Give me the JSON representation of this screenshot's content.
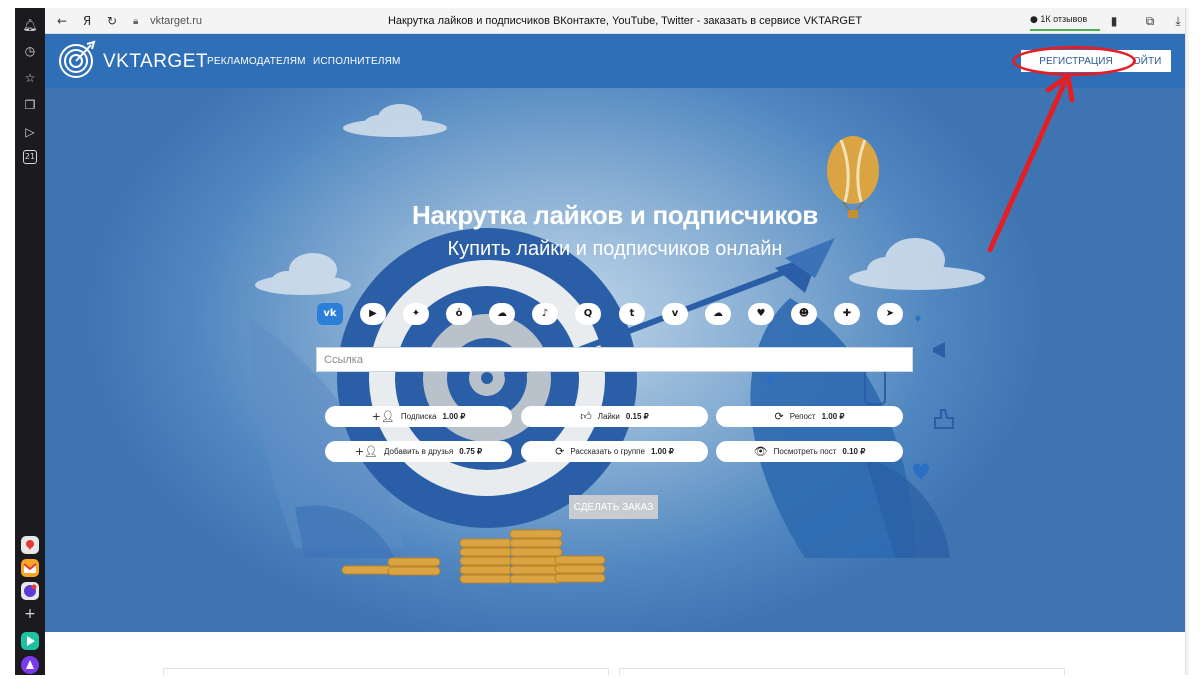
{
  "browser": {
    "url": "vktarget.ru",
    "tab_title": "Накрутка лайков и подписчиков ВКонтакте, YouTube, Twitter - заказать в сервисе VKTARGET",
    "reviews": "1К отзывов",
    "yandex_glyph": "Я",
    "side_badge": "21"
  },
  "header": {
    "logo": "VKTARGET",
    "nav": [
      "РЕКЛАМОДАТЕЛЯМ",
      "ИСПОЛНИТЕЛЯМ"
    ],
    "register": "РЕГИСТРАЦИЯ",
    "login": "ОЙТИ"
  },
  "hero": {
    "title": "Накрутка лайков и подписчиков",
    "subtitle": "Купить лайки и подписчиков онлайн",
    "link_placeholder": "Ссылка",
    "order_button": "СДЕЛАТЬ ЗАКАЗ"
  },
  "socials": [
    {
      "name": "vk-icon",
      "glyph": "vk",
      "active": true
    },
    {
      "name": "youtube-icon",
      "glyph": "▶"
    },
    {
      "name": "twitter-icon",
      "glyph": "✦"
    },
    {
      "name": "odnoklassniki-icon",
      "glyph": "ὀ"
    },
    {
      "name": "cloud-icon",
      "glyph": "☁"
    },
    {
      "name": "tiktok-icon",
      "glyph": "♪"
    },
    {
      "name": "q-icon",
      "glyph": "Q"
    },
    {
      "name": "t-icon",
      "glyph": "t"
    },
    {
      "name": "vimeo-icon",
      "glyph": "v"
    },
    {
      "name": "soundcloud-icon",
      "glyph": "☁"
    },
    {
      "name": "heart-icon",
      "glyph": "♥"
    },
    {
      "name": "reddit-icon",
      "glyph": "☻"
    },
    {
      "name": "plus-icon",
      "glyph": "✚"
    },
    {
      "name": "telegram-icon",
      "glyph": "➤"
    }
  ],
  "services": [
    {
      "icon": "user-plus-icon",
      "glyph": "+👤",
      "label": "Подписка",
      "price": "1.00 ₽"
    },
    {
      "icon": "thumbs-up-icon",
      "glyph": "👍",
      "label": "Лайки",
      "price": "0.15 ₽"
    },
    {
      "icon": "repost-icon",
      "glyph": "⟳",
      "label": "Репост",
      "price": "1.00 ₽"
    },
    {
      "icon": "user-add-icon",
      "glyph": "+👤",
      "label": "Добавить в друзья",
      "price": "0.75 ₽"
    },
    {
      "icon": "share-icon",
      "glyph": "⟳",
      "label": "Рассказать о группе",
      "price": "1.00 ₽"
    },
    {
      "icon": "eye-icon",
      "glyph": "👁",
      "label": "Посмотреть пост",
      "price": "0.10 ₽"
    }
  ],
  "colors": {
    "header": "#2f6fb8",
    "accent": "#2b7fd8",
    "annotation": "#e51e24"
  }
}
